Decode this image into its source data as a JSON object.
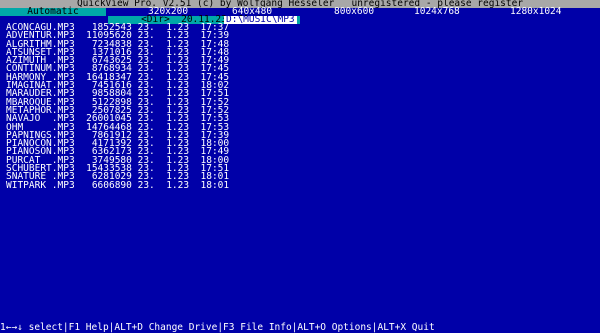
{
  "title": "QuickView Pro. V2.51 (c) by Wolfgang Hesseler   unregistered - please register",
  "modes": {
    "active": "Automatic",
    "options": [
      "320x200",
      "640x480",
      "800x600",
      "1024x768",
      "1280x1024"
    ]
  },
  "header": {
    "dir_text": "<Dir>  20.11.23  15:52",
    "path": "D:\\MUSIC\\MP3"
  },
  "files": [
    {
      "name": "ACONCAGU",
      "ext": "MP3",
      "size": "1852543",
      "date": "23.  1.23",
      "time": "17:37"
    },
    {
      "name": "ADVENTUR",
      "ext": "MP3",
      "size": "11095620",
      "date": "23.  1.23",
      "time": "17:39"
    },
    {
      "name": "ALGRITHM",
      "ext": "MP3",
      "size": "7234838",
      "date": "23.  1.23",
      "time": "17:48"
    },
    {
      "name": "ATSUNSET",
      "ext": "MP3",
      "size": "1371016",
      "date": "23.  1.23",
      "time": "17:48"
    },
    {
      "name": "AZIMUTH",
      "ext": "MP3",
      "size": "6743625",
      "date": "23.  1.23",
      "time": "17:49"
    },
    {
      "name": "CONTINUM",
      "ext": "MP3",
      "size": "8768934",
      "date": "23.  1.23",
      "time": "17:45"
    },
    {
      "name": "HARMONY",
      "ext": "MP3",
      "size": "16418347",
      "date": "23.  1.23",
      "time": "17:45"
    },
    {
      "name": "IMAGINAT",
      "ext": "MP3",
      "size": "7451616",
      "date": "23.  1.23",
      "time": "18:02"
    },
    {
      "name": "MARAUDER",
      "ext": "MP3",
      "size": "9858804",
      "date": "23.  1.23",
      "time": "17:51"
    },
    {
      "name": "MBAROQUE",
      "ext": "MP3",
      "size": "5122898",
      "date": "23.  1.23",
      "time": "17:52"
    },
    {
      "name": "METAPHOR",
      "ext": "MP3",
      "size": "2507825",
      "date": "23.  1.23",
      "time": "17:52"
    },
    {
      "name": "NAVAJO",
      "ext": "MP3",
      "size": "26001045",
      "date": "23.  1.23",
      "time": "17:53"
    },
    {
      "name": "OHM",
      "ext": "MP3",
      "size": "14764468",
      "date": "23.  1.23",
      "time": "17:53"
    },
    {
      "name": "PAPNINGS",
      "ext": "MP3",
      "size": "7861912",
      "date": "23.  1.23",
      "time": "17:39"
    },
    {
      "name": "PIANOCON",
      "ext": "MP3",
      "size": "4171392",
      "date": "23.  1.23",
      "time": "18:00"
    },
    {
      "name": "PIANOSON",
      "ext": "MP3",
      "size": "6362173",
      "date": "23.  1.23",
      "time": "17:49"
    },
    {
      "name": "PURCAT",
      "ext": "MP3",
      "size": "3749580",
      "date": "23.  1.23",
      "time": "18:00"
    },
    {
      "name": "SCHUBERT",
      "ext": "MP3",
      "size": "15433538",
      "date": "23.  1.23",
      "time": "17:51"
    },
    {
      "name": "SNATURE",
      "ext": "MP3",
      "size": "6281029",
      "date": "23.  1.23",
      "time": "18:01"
    },
    {
      "name": "WITPARK",
      "ext": "MP3",
      "size": "6606890",
      "date": "23.  1.23",
      "time": "18:01"
    }
  ],
  "status_bar": "1←→↓ select|F1 Help|ALT+D Change Drive|F3 File Info|ALT+O Options|ALT+X Quit"
}
